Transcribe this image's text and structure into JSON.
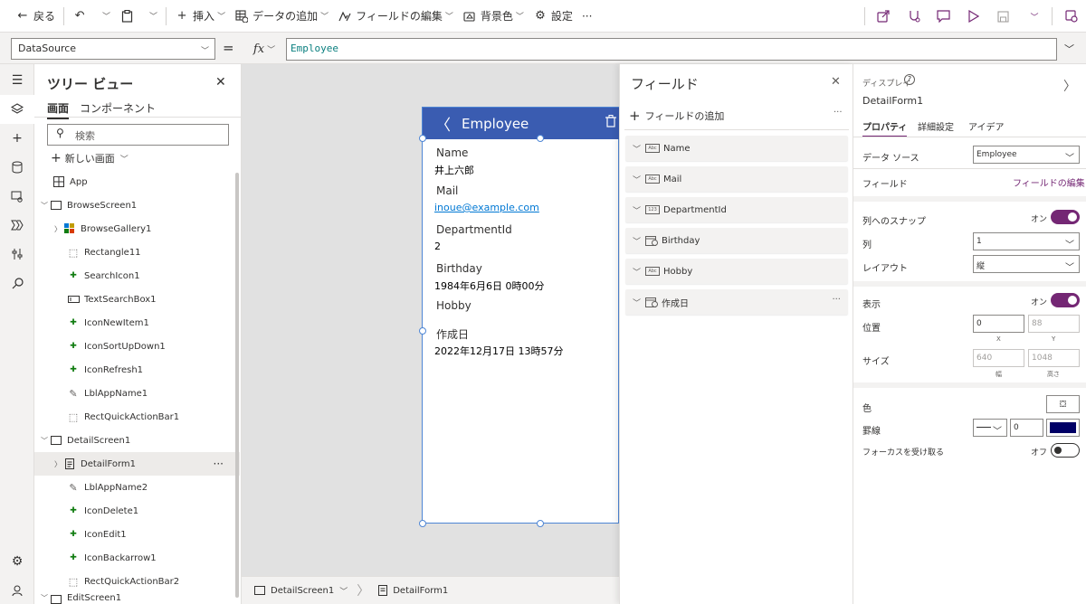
{
  "toolbar": {
    "back": "戻る",
    "insert": "挿入",
    "add_data": "データの追加",
    "edit_fields": "フィールドの編集",
    "background": "背景色",
    "settings": "設定",
    "more": "···"
  },
  "formula_bar": {
    "property": "DataSource",
    "equals": "=",
    "fx": "fx",
    "formula": "Employee"
  },
  "tree": {
    "title": "ツリー ビュー",
    "tabs": [
      "画面",
      "コンポーネント"
    ],
    "search_placeholder": "検索",
    "new_screen": "新しい画面",
    "items": [
      {
        "label": "App"
      },
      {
        "label": "BrowseScreen1"
      },
      {
        "label": "BrowseGallery1"
      },
      {
        "label": "Rectangle11"
      },
      {
        "label": "SearchIcon1"
      },
      {
        "label": "TextSearchBox1"
      },
      {
        "label": "IconNewItem1"
      },
      {
        "label": "IconSortUpDown1"
      },
      {
        "label": "IconRefresh1"
      },
      {
        "label": "LblAppName1"
      },
      {
        "label": "RectQuickActionBar1"
      },
      {
        "label": "DetailScreen1"
      },
      {
        "label": "DetailForm1"
      },
      {
        "label": "LblAppName2"
      },
      {
        "label": "IconDelete1"
      },
      {
        "label": "IconEdit1"
      },
      {
        "label": "IconBackarrow1"
      },
      {
        "label": "RectQuickActionBar2"
      },
      {
        "label": "EditScreen1"
      }
    ]
  },
  "canvas": {
    "header_title": "Employee",
    "fields": [
      {
        "label": "Name",
        "value": "井上六郎"
      },
      {
        "label": "Mail",
        "value": "inoue@example.com"
      },
      {
        "label": "DepartmentId",
        "value": "2"
      },
      {
        "label": "Birthday",
        "value": "1984年6月6日 0時00分"
      },
      {
        "label": "Hobby",
        "value": ""
      },
      {
        "label": "作成日",
        "value": "2022年12月17日 13時57分"
      }
    ],
    "breadcrumb": [
      "DetailScreen1",
      "DetailForm1"
    ]
  },
  "fields_pane": {
    "title": "フィールド",
    "add_field": "フィールドの追加",
    "more": "···",
    "items": [
      {
        "label": "Name",
        "type": "Abc"
      },
      {
        "label": "Mail",
        "type": "Abc"
      },
      {
        "label": "DepartmentId",
        "type": "123"
      },
      {
        "label": "Birthday",
        "type": "date"
      },
      {
        "label": "Hobby",
        "type": "Abc"
      },
      {
        "label": "作成日",
        "type": "date"
      }
    ]
  },
  "props": {
    "category": "ディスプレイ",
    "name": "DetailForm1",
    "tabs": [
      "プロパティ",
      "詳細設定",
      "アイデア"
    ],
    "data_source_label": "データ ソース",
    "data_source_value": "Employee",
    "fields_label": "フィールド",
    "edit_fields_link": "フィールドの編集",
    "snap_label": "列へのスナップ",
    "snap_value": "オン",
    "columns_label": "列",
    "columns_value": "1",
    "layout_label": "レイアウト",
    "layout_value": "縦",
    "visible_label": "表示",
    "visible_value": "オン",
    "position_label": "位置",
    "x_value": "0",
    "y_value": "88",
    "x_sub": "X",
    "y_sub": "Y",
    "size_label": "サイズ",
    "width_value": "640",
    "height_value": "1048",
    "width_sub": "幅",
    "height_sub": "高さ",
    "color_label": "色",
    "border_label": "罫線",
    "border_width": "0",
    "border_color": "#000066",
    "focus_label": "フォーカスを受け取る",
    "focus_value": "オフ"
  },
  "colors": {
    "accent": "#742774",
    "header_blue": "#3a5cb1"
  }
}
